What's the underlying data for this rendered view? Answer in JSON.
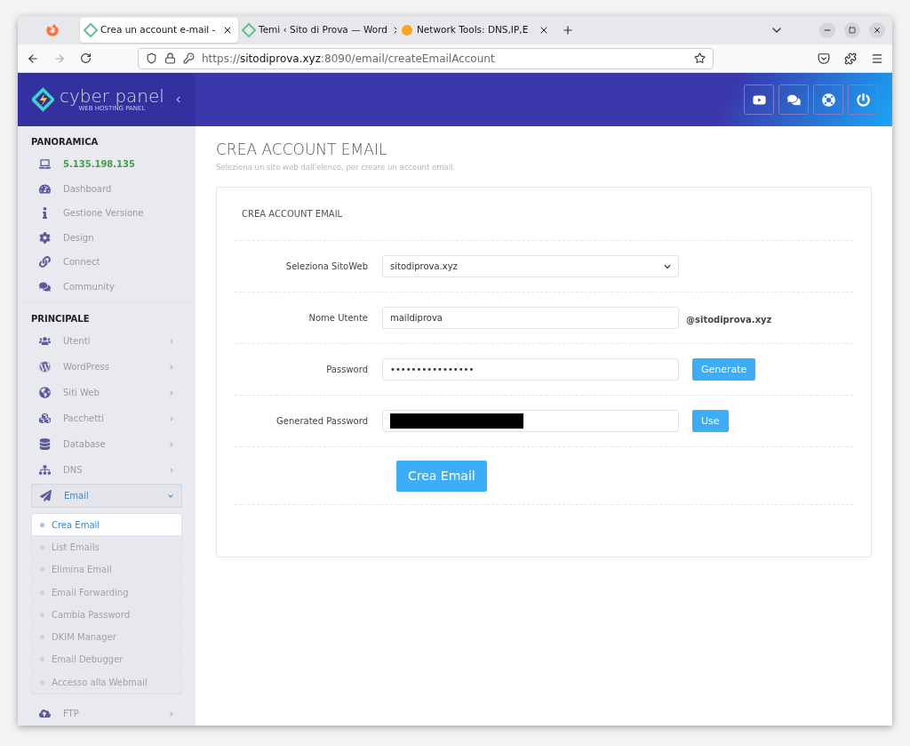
{
  "browser": {
    "tabs": [
      {
        "title": "Crea un account e-mail -",
        "selected": true
      },
      {
        "title": "Temi ‹ Sito di Prova — Word",
        "selected": false
      },
      {
        "title": "Network Tools: DNS,IP,E",
        "selected": false
      }
    ],
    "url": {
      "scheme": "https://",
      "host": "sitodiprova.xyz",
      "path": ":8090/email/createEmailAccount"
    }
  },
  "sidebar": {
    "logo": {
      "name": "cyber panel",
      "tagline": "WEB HOSTING PANEL"
    },
    "sections": [
      {
        "heading": "PANORAMICA",
        "items": [
          {
            "label": "5.135.198.135",
            "kind": "address"
          },
          {
            "label": "Dashboard",
            "kind": "link"
          },
          {
            "label": "Gestione Versione",
            "kind": "link"
          },
          {
            "label": "Design",
            "kind": "link"
          },
          {
            "label": "Connect",
            "kind": "link"
          },
          {
            "label": "Community",
            "kind": "link"
          }
        ]
      },
      {
        "heading": "PRINCIPALE",
        "items": [
          {
            "label": "Utenti",
            "kind": "menu",
            "expanded": false
          },
          {
            "label": "WordPress",
            "kind": "menu",
            "expanded": false
          },
          {
            "label": "Siti Web",
            "kind": "menu",
            "expanded": false
          },
          {
            "label": "Pacchetti",
            "kind": "menu",
            "expanded": false
          },
          {
            "label": "Database",
            "kind": "menu",
            "expanded": false
          },
          {
            "label": "DNS",
            "kind": "menu",
            "expanded": false
          },
          {
            "label": "Email",
            "kind": "menu",
            "expanded": true,
            "children": [
              {
                "label": "Crea Email",
                "selected": true
              },
              {
                "label": "List Emails",
                "selected": false
              },
              {
                "label": "Elimina Email",
                "selected": false
              },
              {
                "label": "Email Forwarding",
                "selected": false
              },
              {
                "label": "Cambia Password",
                "selected": false
              },
              {
                "label": "DKIM Manager",
                "selected": false
              },
              {
                "label": "Email Debugger",
                "selected": false
              },
              {
                "label": "Accesso alla Webmail",
                "selected": false
              }
            ]
          },
          {
            "label": "FTP",
            "kind": "menu",
            "expanded": false
          }
        ]
      }
    ]
  },
  "page": {
    "title": "CREA ACCOUNT EMAIL",
    "subtitle": "Seleziona un sito web dall'elenco, per creare un account email.",
    "card": {
      "title": "CREA ACCOUNT EMAIL",
      "rows": [
        {
          "label": "Seleziona SitoWeb",
          "kind": "select",
          "value": "sitodiprova.xyz"
        },
        {
          "label": "Nome Utente",
          "kind": "text",
          "value": "maildiprova",
          "suffix": "@sitodiprova.xyz"
        },
        {
          "label": "Password",
          "kind": "text",
          "value": "••••••••••••••••",
          "button": "Generate"
        },
        {
          "label": "Generated Password",
          "kind": "redacted",
          "button": "Use"
        }
      ],
      "submit": "Crea Email"
    }
  }
}
